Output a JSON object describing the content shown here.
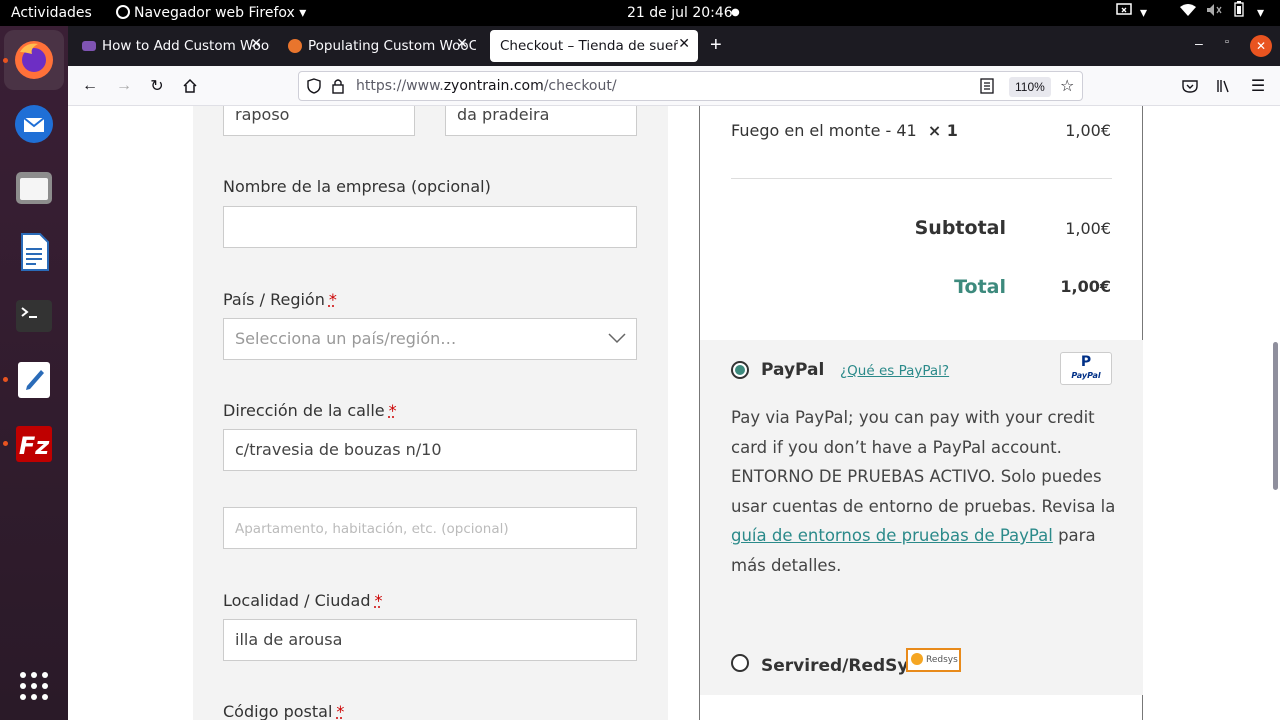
{
  "topbar": {
    "activities": "Actividades",
    "app_menu": "Navegador web Firefox",
    "clock": "21 de jul  20:46"
  },
  "tabs": [
    {
      "title": "How to Add Custom WooC",
      "active": false
    },
    {
      "title": "Populating Custom WooC",
      "active": false
    },
    {
      "title": "Checkout – Tienda de sueños",
      "active": true
    }
  ],
  "navbar": {
    "url_prefix": "https://www.",
    "url_domain": "zyontrain.com",
    "url_path": "/checkout/",
    "zoom": "110%"
  },
  "form": {
    "first_name_value": "raposo",
    "last_name_value": "da pradeira",
    "company_label": "Nombre de la empresa (opcional)",
    "company_value": "",
    "country_label": "País / Región",
    "country_placeholder": "Selecciona un país/región…",
    "street_label": "Dirección de la calle",
    "street_value": "c/travesia de bouzas n/10",
    "apartment_placeholder": "Apartamento, habitación, etc. (opcional)",
    "city_label": "Localidad / Ciudad",
    "city_value": "illa de arousa",
    "postcode_label": "Código postal",
    "required_mark": "*"
  },
  "order": {
    "item_name": "Fuego en el monte - 41",
    "item_qty": "× 1",
    "item_price": "1,00€",
    "subtotal_label": "Subtotal",
    "subtotal_value": "1,00€",
    "total_label": "Total",
    "total_value": "1,00€"
  },
  "payment": {
    "paypal_label": "PayPal",
    "paypal_whatis": "¿Qué es PayPal?",
    "paypal_logo_text": "PayPal",
    "desc_1": "Pay via PayPal; you can pay with your credit card if you don’t have a PayPal account. ENTORNO DE PRUEBAS ACTIVO. Solo puedes usar cuentas de entorno de pruebas. Revisa la ",
    "desc_link": "guía de entornos de pruebas de PayPal",
    "desc_2": " para más detalles.",
    "redsys_label": "Servired/RedSys",
    "redsys_logo_text": "Redsys"
  },
  "colors": {
    "accent_teal": "#3d8a7d",
    "firefox_tabstrip": "#1c1b22",
    "dock": "#2e1a2a"
  }
}
